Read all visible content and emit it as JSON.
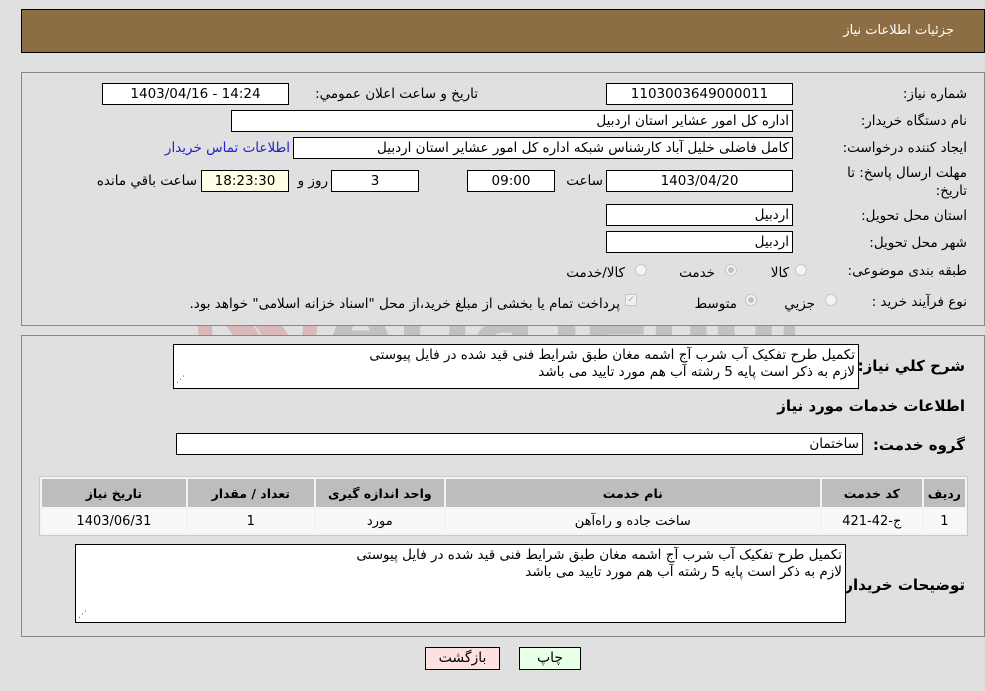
{
  "header": {
    "title": "جزئيات اطلاعات نياز"
  },
  "details": {
    "need_number_label": "شماره نیاز:",
    "need_number": "1103003649000011",
    "announce_label": "تاريخ و ساعت اعلان عمومي:",
    "announce_value": "1403/04/16 - 14:24",
    "buyer_org_label": "نام دستگاه خریدار:",
    "buyer_org": "اداره کل امور عشایر استان اردبیل",
    "creator_label": "ایجاد کننده درخواست:",
    "creator": "کامل فاضلی خلیل آباد کارشناس شبکه اداره کل امور عشایر استان اردبیل",
    "contact_link": "اطلاعات تماس خریدار",
    "deadline_label_line1": "مهلت ارسال پاسخ: تا",
    "deadline_label_line2": "تاریخ:",
    "deadline_date": "1403/04/20",
    "time_label": "ساعت",
    "deadline_time": "09:00",
    "days_value": "3",
    "days_label": "روز و",
    "remaining_time": "18:23:30",
    "remaining_label": "ساعت باقي مانده",
    "province_label": "استان محل تحویل:",
    "province": "اردبیل",
    "city_label": "شهر محل تحویل:",
    "city": "اردبیل",
    "category_label": "طبقه بندی موضوعی:",
    "category_options": [
      "کالا",
      "خدمت",
      "کالا/خدمت"
    ],
    "category_selected": "خدمت",
    "process_label": "نوع فرآیند خرید :",
    "process_options": [
      "جزيي",
      "متوسط"
    ],
    "process_selected": "متوسط",
    "treasury_note": "پرداخت تمام یا بخشی از مبلغ خرید،از محل \"اسناد خزانه اسلامی\" خواهد بود."
  },
  "description": {
    "label": "شرح كلي نياز:",
    "text": "تکمیل طرح تفکیک آب شرب آج اشمه مغان طبق شرایط فنی قید شده در فایل پیوستی\nلازم به ذکر است پایه 5 رشته آب هم مورد تایید می باشد"
  },
  "services": {
    "section_title": "اطلاعات خدمات مورد نياز",
    "group_label": "گروه خدمت:",
    "group_value": "ساختمان",
    "table": {
      "headers": [
        "رديف",
        "کد خدمت",
        "نام خدمت",
        "واحد اندازه گیری",
        "تعداد / مقدار",
        "تاریخ نیاز"
      ],
      "rows": [
        [
          "1",
          "ج-42-421",
          "ساخت جاده و راه‌آهن",
          "مورد",
          "1",
          "1403/06/31"
        ]
      ]
    }
  },
  "buyer_notes": {
    "label": "توضيحات خريدار:",
    "text": "تکمیل طرح تفکیک آب شرب آج اشمه مغان طبق شرایط فنی قید شده در فایل پیوستی\nلازم به ذکر است پایه 5 رشته آب هم مورد تایید می باشد"
  },
  "buttons": {
    "print": "چاپ",
    "back": "بازگشت"
  },
  "watermark": {
    "text": "AriaTender.neT"
  },
  "colors": {
    "header_bg": "#8d6d43",
    "print_bg": "#e8ffe8",
    "back_bg": "#ffe0e0",
    "link": "#2222cc"
  }
}
